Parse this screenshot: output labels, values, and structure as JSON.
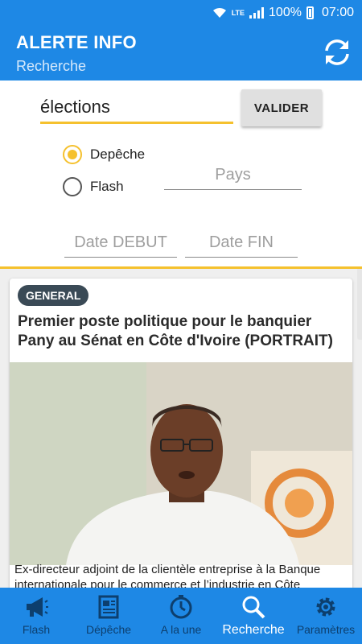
{
  "status_bar": {
    "network": "LTE",
    "battery": "100%",
    "time": "07:00"
  },
  "app_bar": {
    "title": "ALERTE INFO",
    "subtitle": "Recherche",
    "refresh_icon": "refresh-icon"
  },
  "search": {
    "query": "élections",
    "submit_label": "VALIDER",
    "types": [
      {
        "label": "Depêche",
        "checked": true
      },
      {
        "label": "Flash",
        "checked": false
      }
    ],
    "country_placeholder": "Pays",
    "date_start_placeholder": "Date DEBUT",
    "date_end_placeholder": "Date FIN"
  },
  "colors": {
    "primary": "#1e88e5",
    "accent": "#f5c12e",
    "badge": "#3a4a56",
    "inactive_tab": "#0d3f6e"
  },
  "feed": {
    "items": [
      {
        "category": "GENERAL",
        "title": "Premier poste politique pour le banquier Pany au Sénat en Côte d'Ivoire (PORTRAIT)",
        "image": "portrait-photo",
        "excerpt": "Ex-directeur adjoint de la clientèle entreprise à la Banque internationale pour le commerce et l’industrie en Côte"
      }
    ]
  },
  "bottom_nav": {
    "active": "Recherche",
    "tabs": [
      {
        "label": "Flash",
        "icon": "megaphone-icon"
      },
      {
        "label": "Dépêche",
        "icon": "newspaper-icon"
      },
      {
        "label": "A la une",
        "icon": "clock-icon"
      },
      {
        "label": "Recherche",
        "icon": "search-icon"
      },
      {
        "label": "Paramètres",
        "icon": "gear-icon"
      }
    ]
  }
}
